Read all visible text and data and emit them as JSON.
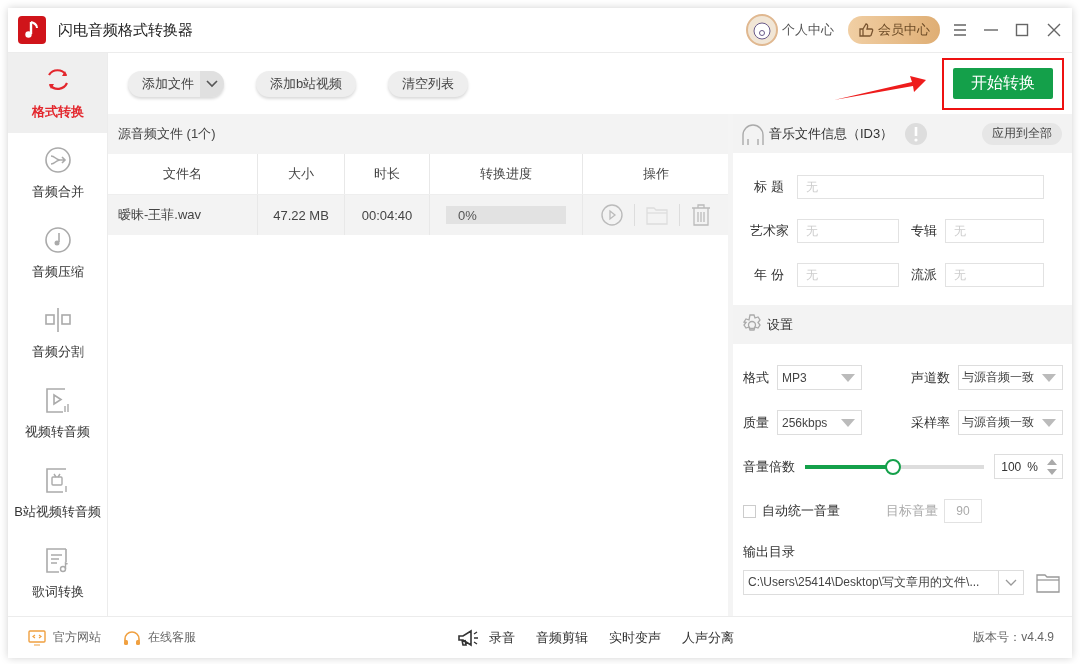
{
  "window": {
    "title": "闪电音频格式转换器"
  },
  "header": {
    "user_center": "个人中心",
    "vip_center": "会员中心"
  },
  "sidebar": {
    "items": [
      {
        "label": "格式转换",
        "selected": true
      },
      {
        "label": "音频合并",
        "selected": false
      },
      {
        "label": "音频压缩",
        "selected": false
      },
      {
        "label": "音频分割",
        "selected": false
      },
      {
        "label": "视频转音频",
        "selected": false
      },
      {
        "label": "B站视频转音频",
        "selected": false
      },
      {
        "label": "歌词转换",
        "selected": false
      }
    ]
  },
  "toolbar": {
    "add_file": "添加文件",
    "add_bilibili": "添加b站视频",
    "clear_list": "清空列表",
    "start": {
      "label": "开始转换",
      "highlighted": true
    }
  },
  "file_list": {
    "title": "源音频文件 (1个)",
    "columns": [
      "文件名",
      "大小",
      "时长",
      "转换进度",
      "操作"
    ],
    "rows": [
      {
        "name": "暧昧-王菲.wav",
        "size": "47.22 MB",
        "duration": "00:04:40",
        "progress": {
          "level": 0,
          "text": "0%"
        }
      }
    ]
  },
  "id3": {
    "title": "音乐文件信息（ID3）",
    "apply_all": "应用到全部",
    "fields": [
      {
        "label": "标 题",
        "placeholder": "无"
      },
      {
        "label": "艺术家",
        "placeholder": "无"
      },
      {
        "label": "专辑",
        "placeholder": "无"
      },
      {
        "label": "年 份",
        "placeholder": "无"
      },
      {
        "label": "流派",
        "placeholder": "无"
      }
    ]
  },
  "settings": {
    "title": "设置",
    "selects": [
      {
        "label": "格式",
        "value": "MP3"
      },
      {
        "label": "声道数",
        "value": "与源音频一致"
      },
      {
        "label": "质量",
        "value": "256kbps"
      },
      {
        "label": "采样率",
        "value": "与源音频一致"
      }
    ],
    "volume": {
      "label": "音量倍数",
      "level": 0.49,
      "value": "100",
      "unit": "%"
    },
    "auto_volume": {
      "label": "自动统一音量",
      "checked": false,
      "target_label": "目标音量",
      "target_value": "90"
    },
    "output": {
      "label": "输出目录",
      "path": "C:\\Users\\25414\\Desktop\\写文章用的文件\\..."
    }
  },
  "footer": {
    "links": [
      "官方网站",
      "在线客服"
    ],
    "tools": [
      "录音",
      "音频剪辑",
      "实时变声",
      "人声分离"
    ],
    "version": "版本号：v4.4.9"
  }
}
